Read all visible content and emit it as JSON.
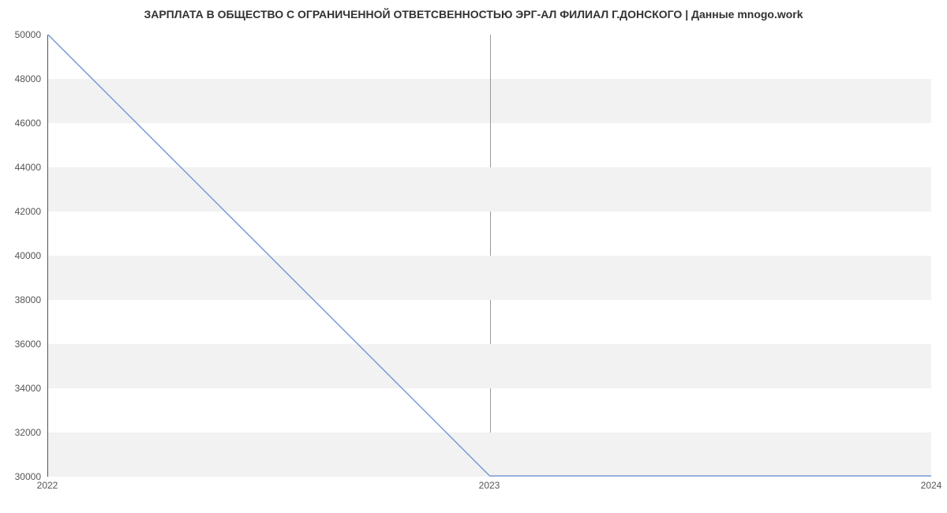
{
  "chart_data": {
    "type": "line",
    "title": "ЗАРПЛАТА В ОБЩЕСТВО С ОГРАНИЧЕННОЙ ОТВЕТСВЕННОСТЬЮ ЭРГ-АЛ ФИЛИАЛ Г.ДОНСКОГО | Данные mnogo.work",
    "xlabel": "",
    "ylabel": "",
    "x": [
      2022,
      2023,
      2024
    ],
    "values": [
      50000,
      30000,
      30000
    ],
    "xlim": [
      2022,
      2024
    ],
    "ylim": [
      30000,
      50000
    ],
    "y_ticks": [
      30000,
      32000,
      34000,
      36000,
      38000,
      40000,
      42000,
      44000,
      46000,
      48000,
      50000
    ],
    "x_ticks": [
      2022,
      2023,
      2024
    ],
    "line_color": "#7a9bd4"
  }
}
